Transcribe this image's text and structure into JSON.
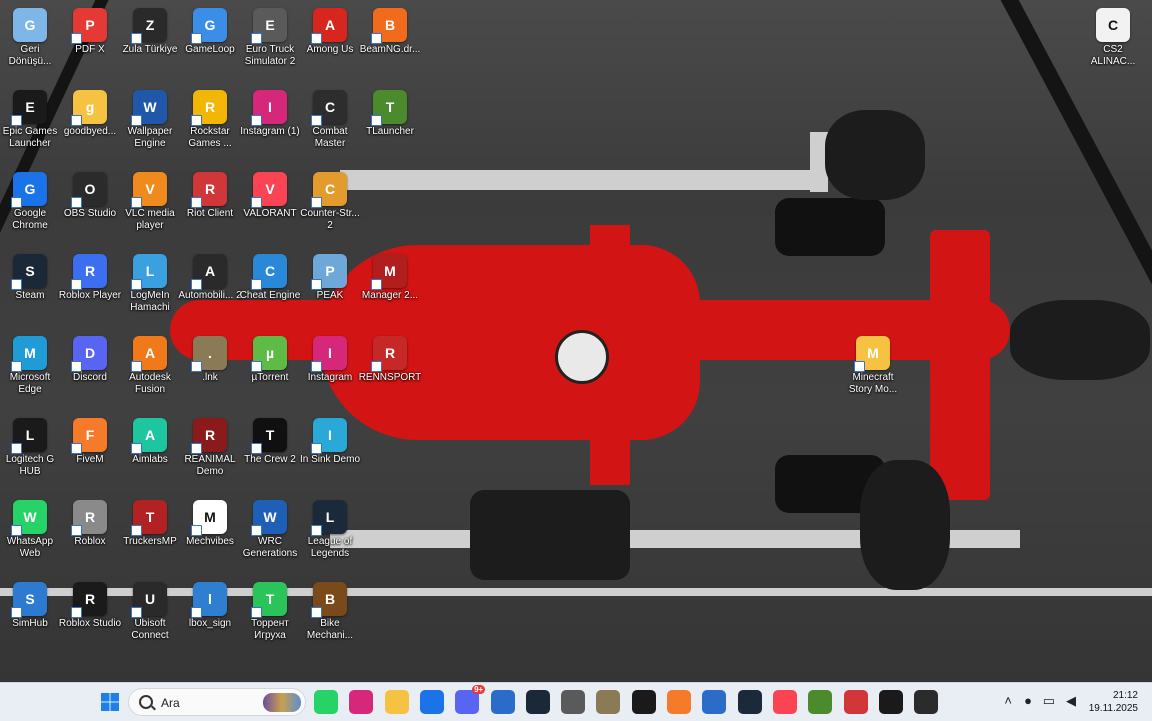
{
  "desktop": {
    "icons": [
      {
        "label": "Geri Dönüşü...",
        "icon": "recycle-bin-icon",
        "color": "#7fb6e8"
      },
      {
        "label": "PDF X",
        "icon": "pdf-x-icon",
        "color": "#e53935"
      },
      {
        "label": "Zula Türkiye",
        "icon": "zula-icon",
        "color": "#2a2a2a"
      },
      {
        "label": "GameLoop",
        "icon": "gameloop-icon",
        "color": "#3b8ee8"
      },
      {
        "label": "Euro Truck Simulator 2",
        "icon": "ets2-icon",
        "color": "#5a5a5a"
      },
      {
        "label": "Among Us",
        "icon": "among-us-icon",
        "color": "#d7261e"
      },
      {
        "label": "BeamNG.dr...",
        "icon": "beamng-icon",
        "color": "#f26b1d"
      },
      {
        "label": "Epic Games Launcher",
        "icon": "epic-games-icon",
        "color": "#1a1a1a"
      },
      {
        "label": "goodbyed...",
        "icon": "folder-icon",
        "color": "#f5c242"
      },
      {
        "label": "Wallpaper Engine",
        "icon": "wallpaper-engine-icon",
        "color": "#2157a8"
      },
      {
        "label": "Rockstar Games ...",
        "icon": "rockstar-icon",
        "color": "#f2b705"
      },
      {
        "label": "Instagram (1)",
        "icon": "instagram-icon",
        "color": "#d6287a"
      },
      {
        "label": "Combat Master",
        "icon": "combat-master-icon",
        "color": "#2d2d2d"
      },
      {
        "label": "TLauncher",
        "icon": "tlauncher-icon",
        "color": "#4c8a2e"
      },
      {
        "label": "Google Chrome",
        "icon": "chrome-icon",
        "color": "#1a73e8"
      },
      {
        "label": "OBS Studio",
        "icon": "obs-icon",
        "color": "#2b2b2b"
      },
      {
        "label": "VLC media player",
        "icon": "vlc-icon",
        "color": "#f08a1c"
      },
      {
        "label": "Riot Client",
        "icon": "riot-client-icon",
        "color": "#d13639"
      },
      {
        "label": "VALORANT",
        "icon": "valorant-icon",
        "color": "#fa4454"
      },
      {
        "label": "Counter-Str... 2",
        "icon": "counter-strike-icon",
        "color": "#e39b2d"
      },
      {
        "label": "Steam",
        "icon": "steam-icon",
        "color": "#1b2838"
      },
      {
        "label": "Roblox Player",
        "icon": "roblox-player-icon",
        "color": "#3b6ff0"
      },
      {
        "label": "LogMeIn Hamachi",
        "icon": "hamachi-icon",
        "color": "#3aa0e0"
      },
      {
        "label": "Automobili... 2",
        "icon": "automobilista-icon",
        "color": "#2a2a2a"
      },
      {
        "label": "Cheat Engine",
        "icon": "cheat-engine-icon",
        "color": "#2a88d8"
      },
      {
        "label": "PEAK",
        "icon": "peak-icon",
        "color": "#6ea8d8"
      },
      {
        "label": "Manager 2...",
        "icon": "manager-icon",
        "color": "#b01e1e"
      },
      {
        "label": "Microsoft Edge",
        "icon": "edge-icon",
        "color": "#1f9bd6"
      },
      {
        "label": "Discord",
        "icon": "discord-icon",
        "color": "#5865f2"
      },
      {
        "label": "Autodesk Fusion",
        "icon": "fusion-icon",
        "color": "#f07a1a"
      },
      {
        "label": ".lnk",
        "icon": "pubg-icon",
        "color": "#8a7a56"
      },
      {
        "label": "µTorrent",
        "icon": "utorrent-icon",
        "color": "#5dbb46"
      },
      {
        "label": "Instagram",
        "icon": "instagram-icon",
        "color": "#d6287a"
      },
      {
        "label": "RENNSPORT",
        "icon": "rennsport-icon",
        "color": "#c62828"
      },
      {
        "label": "Logitech G HUB",
        "icon": "logitech-ghub-icon",
        "color": "#1a1a1a"
      },
      {
        "label": "FiveM",
        "icon": "fivem-icon",
        "color": "#f57b2a"
      },
      {
        "label": "Aimlabs",
        "icon": "aimlabs-icon",
        "color": "#1ec6a0"
      },
      {
        "label": "REANIMAL Demo",
        "icon": "reanimal-icon",
        "color": "#8b1a1a"
      },
      {
        "label": "The Crew 2",
        "icon": "the-crew-2-icon",
        "color": "#101010"
      },
      {
        "label": "In Sink Demo",
        "icon": "in-sink-icon",
        "color": "#2aa8d8"
      },
      {
        "label": "Minecraft Story Mo...",
        "icon": "folder-icon",
        "color": "#f5c242"
      },
      {
        "label": "WhatsApp Web",
        "icon": "whatsapp-icon",
        "color": "#25d366"
      },
      {
        "label": "Roblox",
        "icon": "roblox-icon",
        "color": "#8a8a8a"
      },
      {
        "label": "TruckersMP",
        "icon": "truckersmp-icon",
        "color": "#b22222"
      },
      {
        "label": "Mechvibes",
        "icon": "mechvibes-icon",
        "color": "#ffffff"
      },
      {
        "label": "WRC Generations",
        "icon": "wrc-icon",
        "color": "#1e5fb8"
      },
      {
        "label": "League of Legends",
        "icon": "league-icon",
        "color": "#1a2a3a"
      },
      {
        "label": "SimHub",
        "icon": "simhub-icon",
        "color": "#2d7bd0"
      },
      {
        "label": "Roblox Studio",
        "icon": "roblox-studio-icon",
        "color": "#1a1a1a"
      },
      {
        "label": "Ubisoft Connect",
        "icon": "ubisoft-icon",
        "color": "#2a2a2a"
      },
      {
        "label": "lbox_sign",
        "icon": "document-icon",
        "color": "#2f7fd1"
      },
      {
        "label": "Торрент Игруха",
        "icon": "torrent-igruha-icon",
        "color": "#2bc45a"
      },
      {
        "label": "Bike Mechani...",
        "icon": "bike-mechanic-icon",
        "color": "#7a4a1a"
      },
      {
        "label": "CS2 ALINAC...",
        "icon": "text-file-icon",
        "color": "#f2f2f2"
      }
    ]
  },
  "taskbar": {
    "search_placeholder": "Ara",
    "apps": [
      {
        "name": "whatsapp",
        "color": "#25d366"
      },
      {
        "name": "instagram",
        "color": "#d6287a"
      },
      {
        "name": "file-explorer",
        "color": "#f5c242"
      },
      {
        "name": "chrome",
        "color": "#1a73e8"
      },
      {
        "name": "discord",
        "color": "#5865f2",
        "badge": "9+"
      },
      {
        "name": "xbox",
        "color": "#2a6cc7"
      },
      {
        "name": "steam",
        "color": "#1b2838"
      },
      {
        "name": "roblox",
        "color": "#5a5a5a"
      },
      {
        "name": "pubg",
        "color": "#8a7a56"
      },
      {
        "name": "epic-games",
        "color": "#1a1a1a"
      },
      {
        "name": "fivem",
        "color": "#f57b2a"
      },
      {
        "name": "app-store",
        "color": "#2a6cc7"
      },
      {
        "name": "league-of-legends",
        "color": "#1a2a3a"
      },
      {
        "name": "valorant",
        "color": "#fa4454"
      },
      {
        "name": "minecraft",
        "color": "#4c8a2e"
      },
      {
        "name": "roblox-studio",
        "color": "#d13639"
      },
      {
        "name": "epic-launcher",
        "color": "#1a1a1a"
      },
      {
        "name": "obs",
        "color": "#2b2b2b"
      }
    ],
    "clock": {
      "time": "21:12",
      "date": "19.11.2025"
    }
  }
}
